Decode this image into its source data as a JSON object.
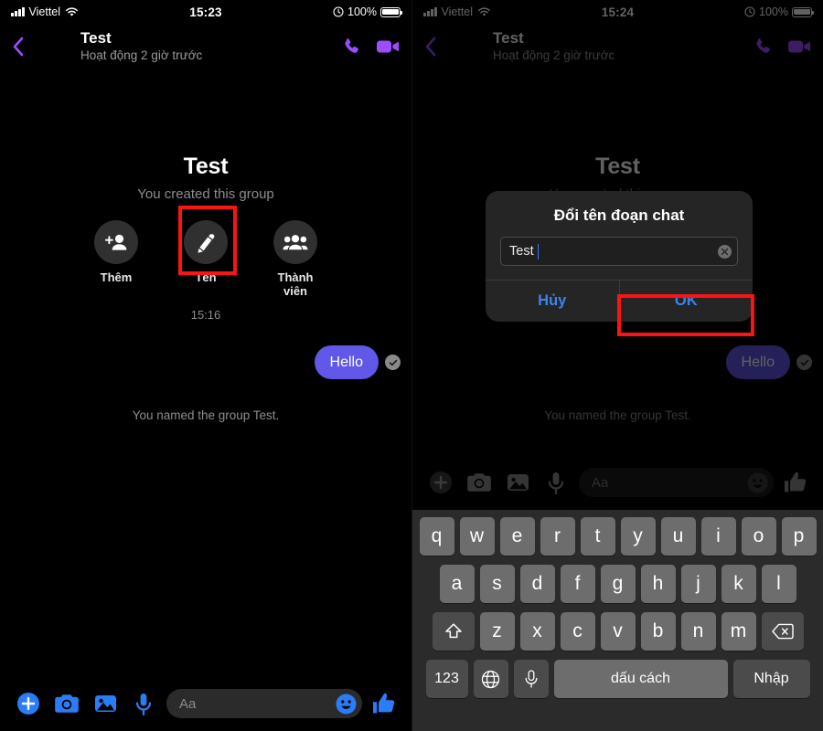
{
  "left_panel": {
    "status_bar": {
      "carrier": "Viettel",
      "time": "15:23",
      "battery_percent": "100%",
      "signal_icon": "signal-bars-icon",
      "wifi_icon": "wifi-icon",
      "battery_icon": "battery-full-icon",
      "alarm_icon": "alarm-clock-icon"
    },
    "nav": {
      "back_icon": "back-chevron-icon",
      "title": "Test",
      "subtitle": "Hoạt động 2 giờ trước",
      "call_icon": "phone-call-icon",
      "video_icon": "video-camera-icon",
      "accent_color": "#9b4dff"
    },
    "intro": {
      "group_name": "Test",
      "description": "You created this group",
      "actions": [
        {
          "label": "Thêm",
          "icon": "add-person-icon"
        },
        {
          "label": "Tên",
          "icon": "pencil-edit-icon"
        },
        {
          "label": "Thành viên",
          "icon": "members-group-icon"
        }
      ],
      "timestamp": "15:16"
    },
    "messages": [
      {
        "type": "bubble",
        "text": "Hello",
        "outgoing": true,
        "status_icon": "seen-check-icon",
        "color": "#6157e8"
      },
      {
        "type": "system",
        "text": "You named the group Test."
      }
    ],
    "composer": {
      "placeholder": "Aa",
      "icons": [
        "plus-circle-icon",
        "camera-icon",
        "photo-gallery-icon",
        "microphone-icon",
        "emoji-smiley-icon",
        "thumbs-up-icon"
      ],
      "accent_color": "#2b7cf7"
    },
    "highlight": {
      "target": "Tên",
      "color": "#fc1414"
    }
  },
  "right_panel": {
    "status_bar": {
      "carrier": "Viettel",
      "time": "15:24",
      "battery_percent": "100%"
    },
    "nav": {
      "title": "Test",
      "subtitle": "Hoạt động 2 giờ trước"
    },
    "intro": {
      "group_name": "Test",
      "description": "You created this group"
    },
    "dialog": {
      "title": "Đổi tên đoạn chat",
      "input_value": "Test",
      "clear_icon": "clear-text-icon",
      "buttons": [
        {
          "label": "Hủy",
          "name": "cancel-button"
        },
        {
          "label": "OK",
          "name": "ok-button"
        }
      ],
      "highlight": {
        "target": "OK",
        "color": "#fc1414"
      }
    },
    "messages": [
      {
        "type": "bubble",
        "text": "Hello",
        "outgoing": true
      },
      {
        "type": "system",
        "text": "You named the group Test."
      }
    ],
    "composer": {
      "placeholder": "Aa"
    },
    "keyboard": {
      "row1": [
        "q",
        "w",
        "e",
        "r",
        "t",
        "y",
        "u",
        "i",
        "o",
        "p"
      ],
      "row2": [
        "a",
        "s",
        "d",
        "f",
        "g",
        "h",
        "j",
        "k",
        "l"
      ],
      "row3": [
        "z",
        "x",
        "c",
        "v",
        "b",
        "n",
        "m"
      ],
      "shift_icon": "shift-arrow-icon",
      "backspace_icon": "backspace-delete-icon",
      "numbers_key": "123",
      "globe_icon": "globe-language-icon",
      "mic_icon": "microphone-icon",
      "space_key": "dấu cách",
      "enter_key": "Nhập"
    }
  }
}
